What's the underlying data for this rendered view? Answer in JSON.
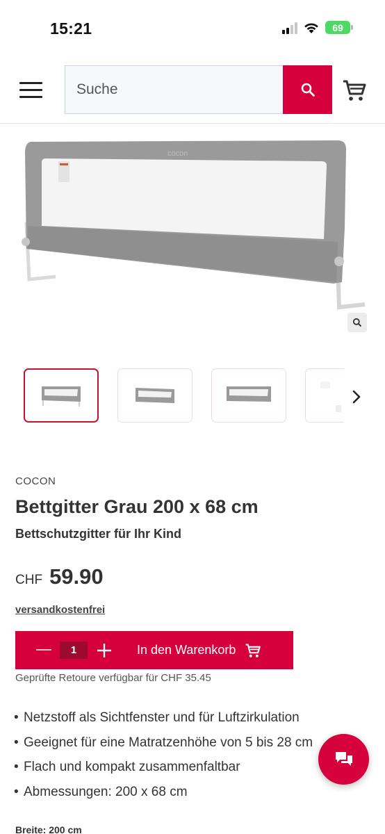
{
  "status_bar": {
    "time": "15:21",
    "battery": "69"
  },
  "header": {
    "search_placeholder": "Suche"
  },
  "product": {
    "brand": "COCON",
    "title": "Bettgitter Grau 200 x 68 cm",
    "subtitle": "Bettschutzgitter für Ihr Kind",
    "image_label": "cocon",
    "thumbnail_count": 4,
    "active_thumbnail": 1
  },
  "pricing": {
    "currency": "CHF",
    "price": "59.90",
    "shipping": "versandkostenfrei"
  },
  "cart": {
    "quantity": "1",
    "add_label": "In den Warenkorb"
  },
  "return_note": "Geprüfte Retoure verfügbar für CHF 35.45",
  "features": [
    "Netzstoff als Sichtfenster und für Luftzirkulation",
    "Geeignet für eine Matratzenhöhe von 5 bis 28 cm",
    "Flach und kompakt zusammenfaltbar",
    "Abmessungen: 200 x 68 cm"
  ],
  "specs": {
    "width_label": "Breite: 200 cm"
  },
  "colors": {
    "accent": "#d6003c",
    "accent_dark": "#9c0a2e",
    "battery": "#4cd964"
  }
}
